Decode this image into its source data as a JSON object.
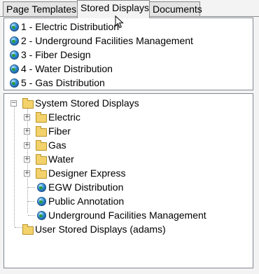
{
  "tabs": [
    {
      "label": "Page Templates"
    },
    {
      "label": "Stored Displays",
      "active": true
    },
    {
      "label": "Documents"
    }
  ],
  "stored_displays": [
    {
      "label": "1 - Electric Distribution",
      "icon": "globe-icon"
    },
    {
      "label": "2 - Underground Facilities Management",
      "icon": "globe-icon"
    },
    {
      "label": "3 - Fiber Design",
      "icon": "globe-icon"
    },
    {
      "label": "4 - Water Distribution",
      "icon": "globe-icon"
    },
    {
      "label": "5 - Gas Distribution",
      "icon": "globe-icon"
    }
  ],
  "tree": {
    "root_system": {
      "label": "System Stored Displays",
      "expanded": true,
      "expander": "−"
    },
    "children": [
      {
        "label": "Electric",
        "type": "folder",
        "expander": "+"
      },
      {
        "label": "Fiber",
        "type": "folder",
        "expander": "+"
      },
      {
        "label": "Gas",
        "type": "folder",
        "expander": "+"
      },
      {
        "label": "Water",
        "type": "folder",
        "expander": "+"
      },
      {
        "label": "Designer Express",
        "type": "folder",
        "expander": "+"
      },
      {
        "label": "EGW Distribution",
        "type": "display"
      },
      {
        "label": "Public Annotation",
        "type": "display"
      },
      {
        "label": "Underground Facilities Management",
        "type": "display"
      }
    ],
    "root_user": {
      "label": "User Stored Displays (adams)"
    }
  },
  "colors": {
    "folder": "#f3d26b",
    "globe": "#2e8fd4",
    "panel_border": "#828790"
  }
}
